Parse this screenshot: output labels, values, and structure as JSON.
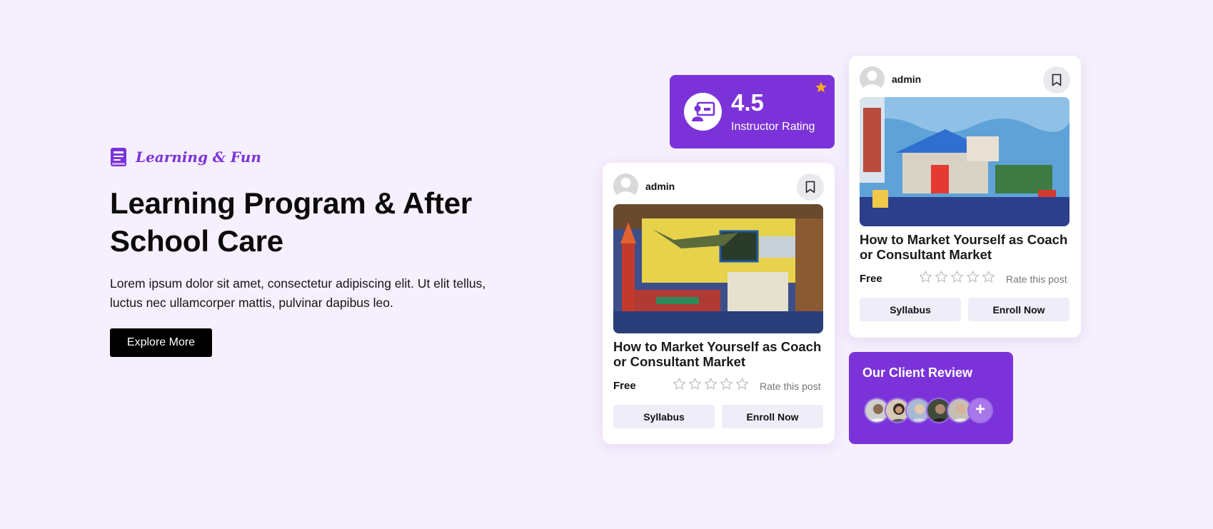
{
  "hero": {
    "tagline": "Learning & Fun",
    "title": "Learning Program & After School Care",
    "description": "Lorem ipsum dolor sit amet, consectetur adipiscing elit. Ut elit tellus, luctus nec ullamcorper mattis, pulvinar dapibus leo.",
    "button_label": "Explore More",
    "icon": "book-icon"
  },
  "rating": {
    "value": "4.5",
    "label": "Instructor Rating",
    "icon": "teacher-board-icon",
    "badge_icon": "star-icon"
  },
  "courses": [
    {
      "author": "admin",
      "title": "How to Market Yourself as Coach or Consultant Market",
      "price": "Free",
      "stars": 0,
      "stars_max": 5,
      "rate_text": "Rate this post",
      "syllabus_label": "Syllabus",
      "enroll_label": "Enroll Now",
      "image": "classroom-photo"
    },
    {
      "author": "admin",
      "title": "How to Market Yourself as Coach or Consultant Market",
      "price": "Free",
      "stars": 0,
      "stars_max": 5,
      "rate_text": "Rate this post",
      "syllabus_label": "Syllabus",
      "enroll_label": "Enroll Now",
      "image": "playroom-photo"
    }
  ],
  "review": {
    "title": "Our Client Review",
    "more_icon": "plus-icon"
  },
  "colors": {
    "background": "#f6effd",
    "accent": "#7b33d9",
    "star": "#f5a623"
  }
}
